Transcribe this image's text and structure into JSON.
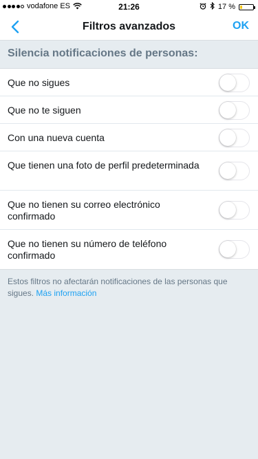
{
  "status_bar": {
    "carrier": "vodafone ES",
    "time": "21:26",
    "battery_percent": "17 %",
    "battery_level": 0.17,
    "icons": [
      "signal-dots",
      "wifi-icon",
      "alarm-icon",
      "bluetooth-icon",
      "battery-icon"
    ]
  },
  "nav": {
    "back_icon": "chevron-left-icon",
    "title": "Filtros avanzados",
    "ok_label": "OK"
  },
  "section": {
    "header": "Silencia notificaciones de personas:"
  },
  "filters": [
    {
      "label": "Que no sigues",
      "enabled": false
    },
    {
      "label": "Que no te siguen",
      "enabled": false
    },
    {
      "label": "Con una nueva cuenta",
      "enabled": false
    },
    {
      "label": "Que tienen una foto de perfil predeterminada",
      "enabled": false
    },
    {
      "label": "Que no tienen su correo electrónico confirmado",
      "enabled": false
    },
    {
      "label": "Que no tienen su número de teléfono confirmado",
      "enabled": false
    }
  ],
  "footer": {
    "note": "Estos filtros no afectarán notificaciones de las personas que sigues.",
    "link": "Más información"
  },
  "colors": {
    "accent": "#1da1f2",
    "background": "#e6ecf0",
    "secondary_text": "#657786",
    "battery": "#f5c518"
  }
}
